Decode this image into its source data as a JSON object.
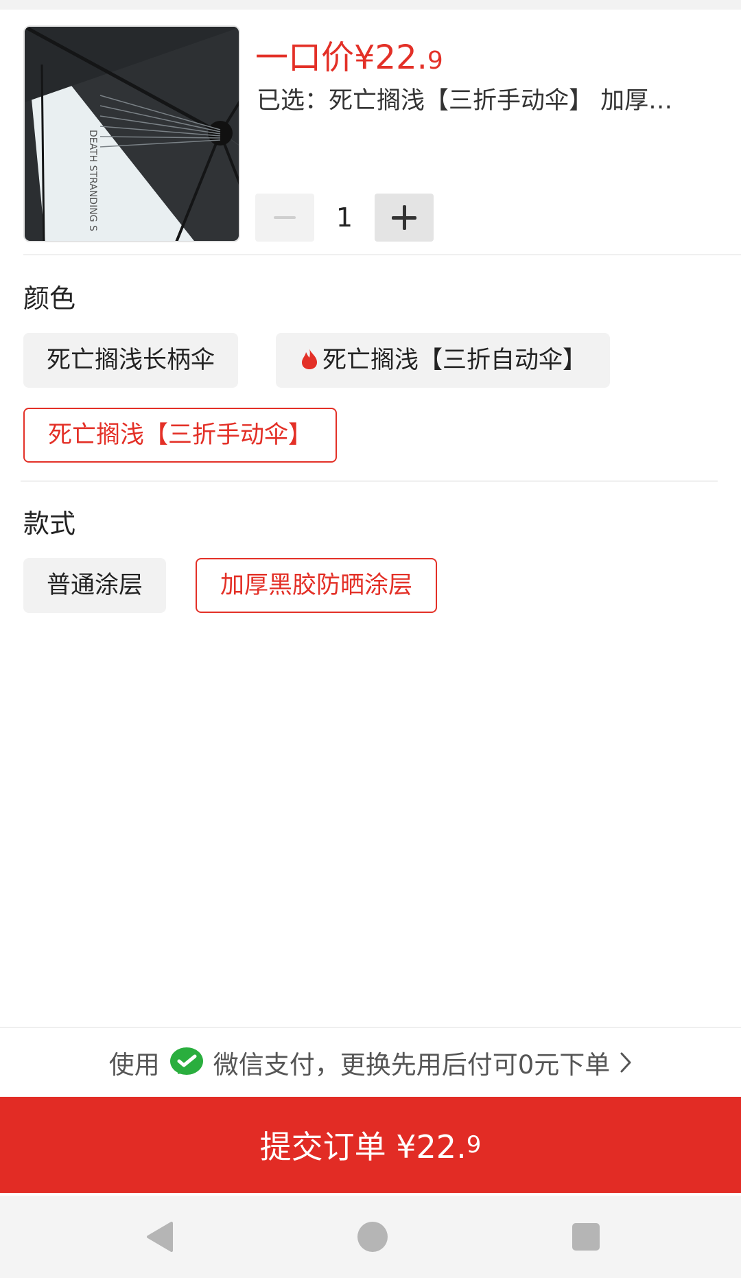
{
  "product": {
    "price_prefix": "一口价¥",
    "price_int": "22.",
    "price_dec": "9",
    "selected_text": "已选：死亡搁浅【三折手动伞】 加厚黑胶防晒涂层",
    "quantity": "1",
    "image_text": "DEATH STRANDING S"
  },
  "color_section": {
    "title": "颜色",
    "options": [
      {
        "label": "死亡搁浅长柄伞",
        "selected": false
      },
      {
        "label": "死亡搁浅【三折自动伞】",
        "selected": false,
        "hot": true
      },
      {
        "label": "死亡搁浅【三折手动伞】",
        "selected": true
      }
    ]
  },
  "style_section": {
    "title": "款式",
    "options": [
      {
        "label": "普通涂层",
        "selected": false
      },
      {
        "label": "加厚黑胶防晒涂层",
        "selected": true
      }
    ]
  },
  "payment": {
    "prefix": "使用",
    "text": "微信支付，更换先用后付可0元下单",
    "icon": "wechat-pay-icon"
  },
  "submit": {
    "label": "提交订单 ¥22.",
    "dec": "9"
  },
  "colors": {
    "accent": "#e33027",
    "submit_bg": "#e22c25",
    "wechat_green": "#2aae3e"
  }
}
